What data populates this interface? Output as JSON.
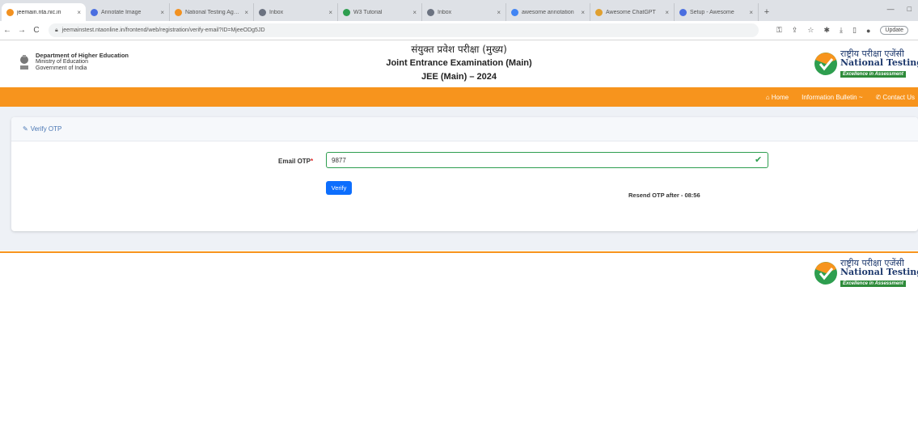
{
  "browser": {
    "tabs": [
      {
        "title": "jeemain.nta.nic.in",
        "fav_color": "#f29120",
        "active": true
      },
      {
        "title": "Annotate Image",
        "fav_color": "#4a6ee0"
      },
      {
        "title": "National Testing Agency",
        "fav_color": "#f29120"
      },
      {
        "title": "Inbox",
        "fav_color": "#6b7280"
      },
      {
        "title": "W3 Tutorial",
        "fav_color": "#2e9e4f"
      },
      {
        "title": "Inbox",
        "fav_color": "#6b7280"
      },
      {
        "title": "awesome annotation",
        "fav_color": "#4285f4"
      },
      {
        "title": "Awesome ChatGPT",
        "fav_color": "#e0a030"
      },
      {
        "title": "Setup - Awesome",
        "fav_color": "#4a6ee0"
      }
    ],
    "new_tab": "+",
    "url": "jeemainstest.ntaonline.in/frontend/web/registration/verify-email?ID=MjeeODg5JD",
    "update_label": "Update"
  },
  "header": {
    "dept_lines": [
      "Department of Higher Education",
      "Ministry of Education",
      "Government of India"
    ],
    "title_hi": "संयुक्त प्रवेश परीक्षा (मुख्य)",
    "title_en": "Joint Entrance Examination (Main)",
    "title_year": "JEE (Main) – 2024",
    "nta_hi": "राष्ट्रीय परीक्षा एजेंसी",
    "nta_en": "National Testing Agency",
    "nta_tag": "Excellence in Assessment"
  },
  "nav": {
    "home": "Home",
    "info": "Information Bulletin ~",
    "contact": "Contact Us"
  },
  "verify": {
    "card_title": "Verify OTP",
    "otp_label": "Email OTP",
    "required_mark": "*",
    "otp_value": "9877",
    "verify_label": "Verify",
    "resend_text": "Resend OTP after - 08:56"
  },
  "colors": {
    "orange": "#f7941d",
    "primary": "#0d6efd",
    "success": "#2e9e4f"
  }
}
